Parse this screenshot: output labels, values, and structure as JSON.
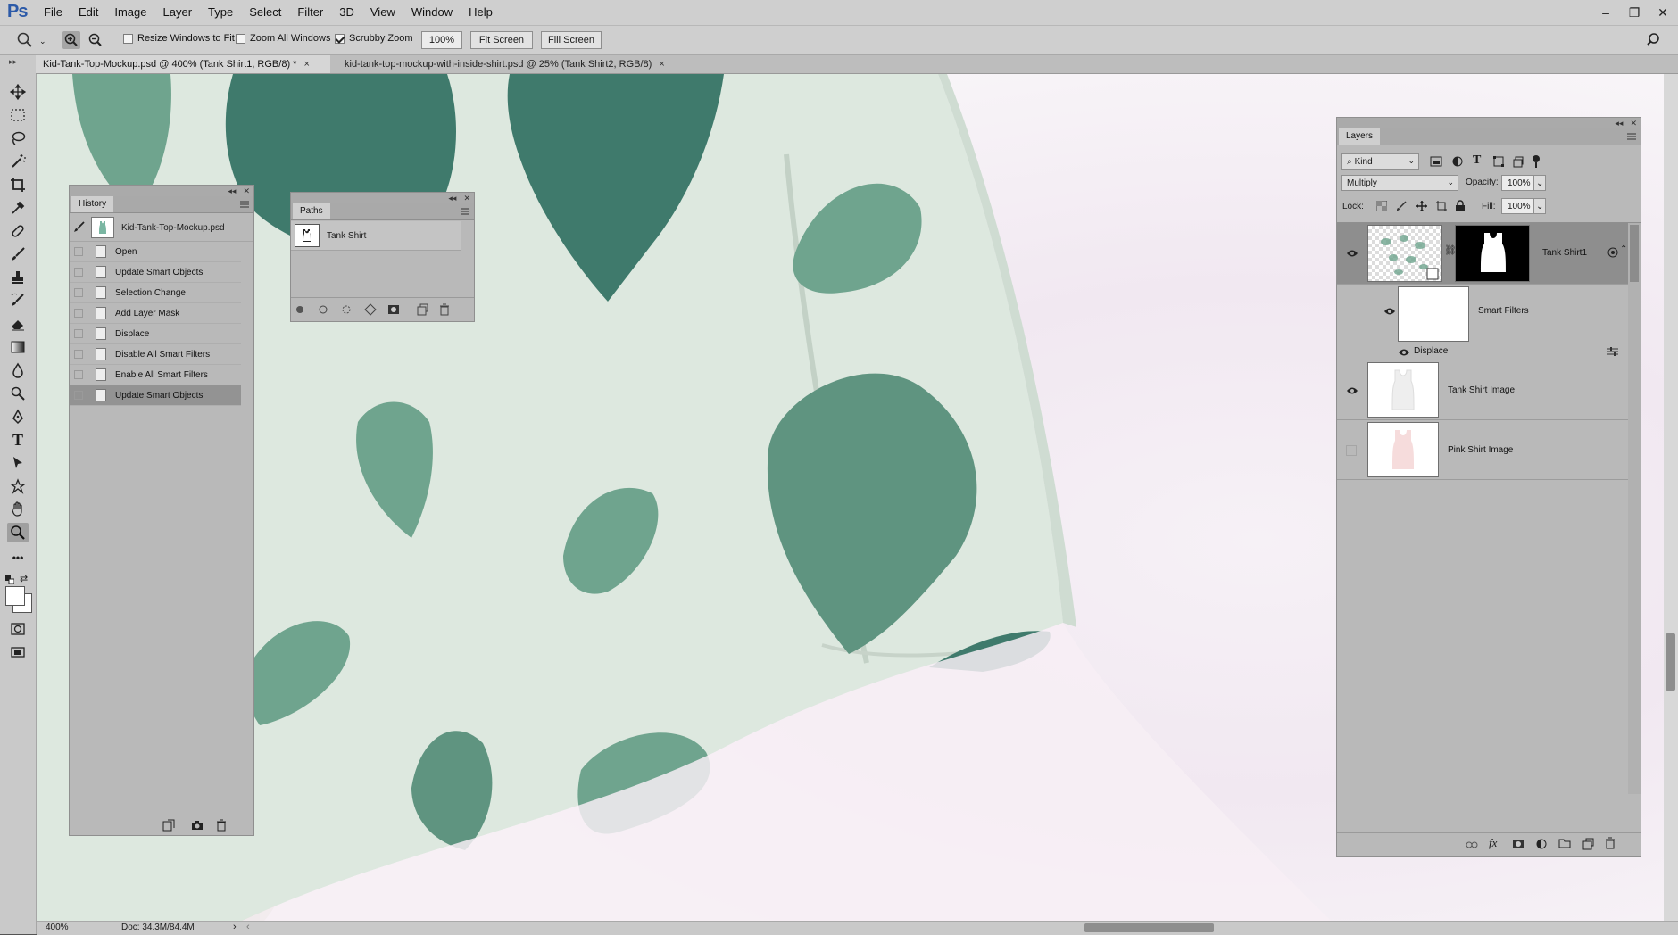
{
  "app": {
    "logo": "Ps"
  },
  "menu": [
    "File",
    "Edit",
    "Image",
    "Layer",
    "Type",
    "Select",
    "Filter",
    "3D",
    "View",
    "Window",
    "Help"
  ],
  "options_bar": {
    "resize_windows_label": "Resize Windows to Fit",
    "zoom_all_label": "Zoom All Windows",
    "scrubby_zoom_label": "Scrubby Zoom",
    "zoom_value": "100%",
    "fit_screen_label": "Fit Screen",
    "fill_screen_label": "Fill Screen",
    "resize_windows_checked": false,
    "zoom_all_checked": false,
    "scrubby_zoom_checked": true
  },
  "tabs": [
    {
      "label": "Kid-Tank-Top-Mockup.psd @ 400% (Tank Shirt1, RGB/8) *",
      "close": "×"
    },
    {
      "label": "kid-tank-top-mockup-with-inside-shirt.psd @ 25% (Tank Shirt2, RGB/8)",
      "close": "×"
    }
  ],
  "history": {
    "title": "History",
    "snapshot_label": "Kid-Tank-Top-Mockup.psd",
    "items": [
      "Open",
      "Update Smart Objects",
      "Selection Change",
      "Add Layer Mask",
      "Displace",
      "Disable All Smart Filters",
      "Enable All Smart Filters",
      "Update Smart Objects"
    ]
  },
  "paths": {
    "title": "Paths",
    "items": [
      "Tank Shirt"
    ]
  },
  "layers": {
    "title": "Layers",
    "filter_kind": "Kind",
    "blend_mode": "Multiply",
    "opacity_label": "Opacity:",
    "opacity_value": "100%",
    "lock_label": "Lock:",
    "fill_label": "Fill:",
    "fill_value": "100%",
    "items": [
      {
        "name": "Tank Shirt1"
      },
      {
        "name": "Smart Filters"
      },
      {
        "name": "Displace"
      },
      {
        "name": "Tank Shirt Image"
      },
      {
        "name": "Pink Shirt Image"
      }
    ]
  },
  "status": {
    "zoom": "400%",
    "doc": "Doc: 34.3M/84.4M"
  },
  "colors": {
    "leaf_light": "#6fa48e",
    "leaf_dark": "#3f7a6c",
    "fabric": "#dfe9e1"
  }
}
